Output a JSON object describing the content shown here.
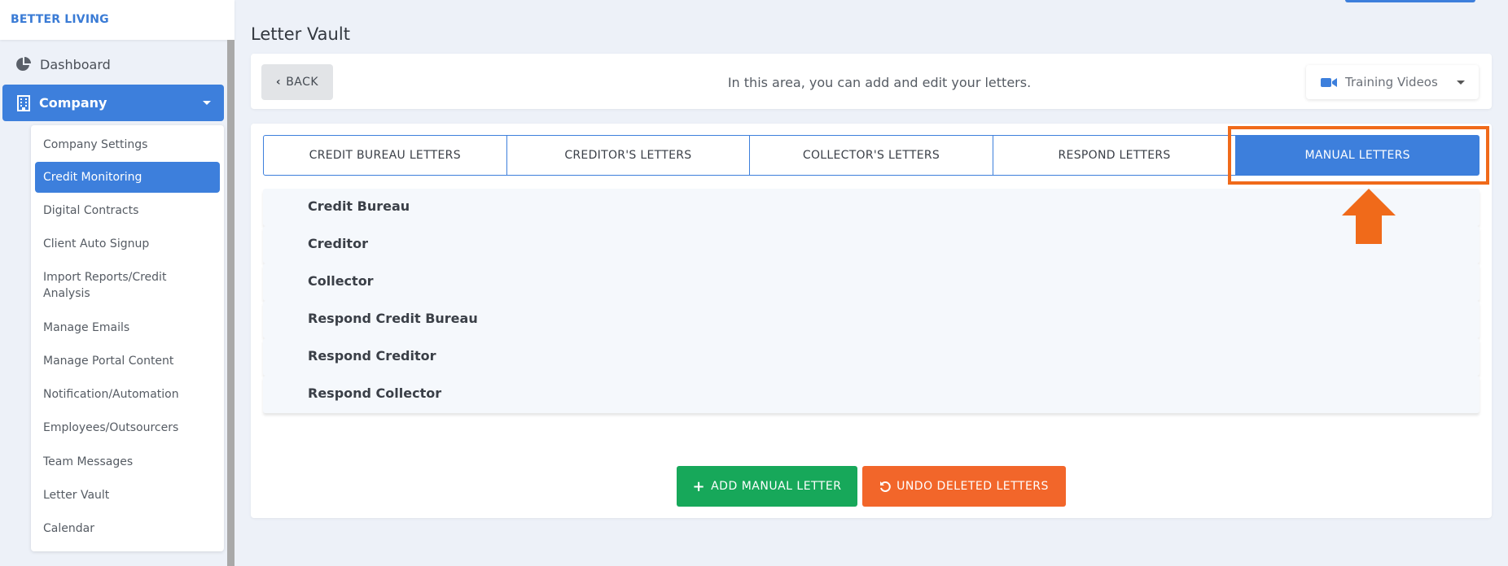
{
  "brand": "BETTER LIVING",
  "nav": {
    "dashboard": "Dashboard",
    "company": "Company",
    "submenu": [
      "Company Settings",
      "Credit Monitoring",
      "Digital Contracts",
      "Client Auto Signup",
      "Import Reports/Credit Analysis",
      "Manage Emails",
      "Manage Portal Content",
      "Notification/Automation",
      "Employees/Outsourcers",
      "Team Messages",
      "Letter Vault",
      "Calendar"
    ],
    "active_submenu": "Credit Monitoring"
  },
  "page": {
    "title": "Letter Vault",
    "back_label": "BACK",
    "message": "In this area, you can add and edit your letters.",
    "training_label": "Training Videos"
  },
  "tabs": [
    "CREDIT BUREAU LETTERS",
    "CREDITOR'S LETTERS",
    "COLLECTOR'S LETTERS",
    "RESPOND LETTERS",
    "MANUAL LETTERS"
  ],
  "active_tab": "MANUAL LETTERS",
  "sections": [
    "Credit Bureau",
    "Creditor",
    "Collector",
    "Respond Credit Bureau",
    "Respond Creditor",
    "Respond Collector"
  ],
  "actions": {
    "add": "ADD MANUAL LETTER",
    "undo": "UNDO DELETED LETTERS"
  },
  "colors": {
    "accent": "#3d7fdc",
    "highlight": "#f06a1a",
    "add_button": "#17a85a",
    "undo_button": "#f2662a"
  },
  "icons": {
    "dashboard": "pie-chart-icon",
    "company": "building-icon",
    "training": "video-camera-icon",
    "add": "plus-icon",
    "undo": "undo-icon",
    "annotation": "arrow-up-icon"
  }
}
